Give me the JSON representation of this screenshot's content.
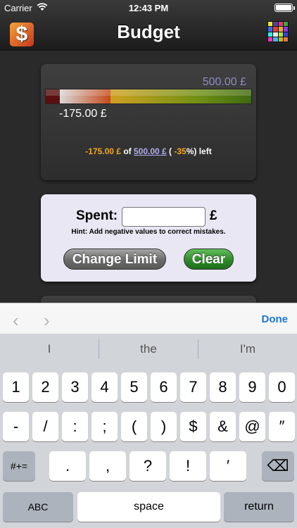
{
  "status_bar": {
    "carrier": "Carrier",
    "time": "12:43 PM"
  },
  "nav": {
    "title": "Budget",
    "app_icon_glyph": "$"
  },
  "grid_colors": [
    "#e8e83a",
    "#5a3aa8",
    "#e23a7a",
    "#3aa83a",
    "#3a6ae8",
    "#e83a3a",
    "#e8a83a",
    "#8a3ae8",
    "#3ae8e8",
    "#e8e8e8",
    "#a8e83a",
    "#3a3ae8",
    "#e83ab8",
    "#3ab8e8",
    "#b8b83a",
    "#e87a3a"
  ],
  "budget": {
    "limit_label": "500.00 £",
    "spent_label": "-175.00 £",
    "summary_spent": "-175.00 £",
    "summary_of": " of ",
    "summary_limit": "500.00 £",
    "summary_open": " ( ",
    "summary_percent": "-35",
    "summary_close": "%) left"
  },
  "form": {
    "spent_label": "Spent:",
    "spent_value": "",
    "currency": "£",
    "hint": "Hint: Add negative values to correct mistakes.",
    "change_limit_button": "Change Limit",
    "clear_button": "Clear"
  },
  "keyboard_toolbar": {
    "prev": "‹",
    "next": "›",
    "done": "Done"
  },
  "suggestions": [
    "I",
    "the",
    "I'm"
  ],
  "keys": {
    "row1": [
      "1",
      "2",
      "3",
      "4",
      "5",
      "6",
      "7",
      "8",
      "9",
      "0"
    ],
    "row2": [
      "-",
      "/",
      ":",
      ";",
      "(",
      ")",
      "$",
      "&",
      "@",
      "″"
    ],
    "row3_mode": "#+=",
    "row3": [
      ".",
      ",",
      "?",
      "!",
      "′"
    ],
    "delete": "⌫",
    "abc": "ABC",
    "space": "space",
    "return": "return"
  }
}
